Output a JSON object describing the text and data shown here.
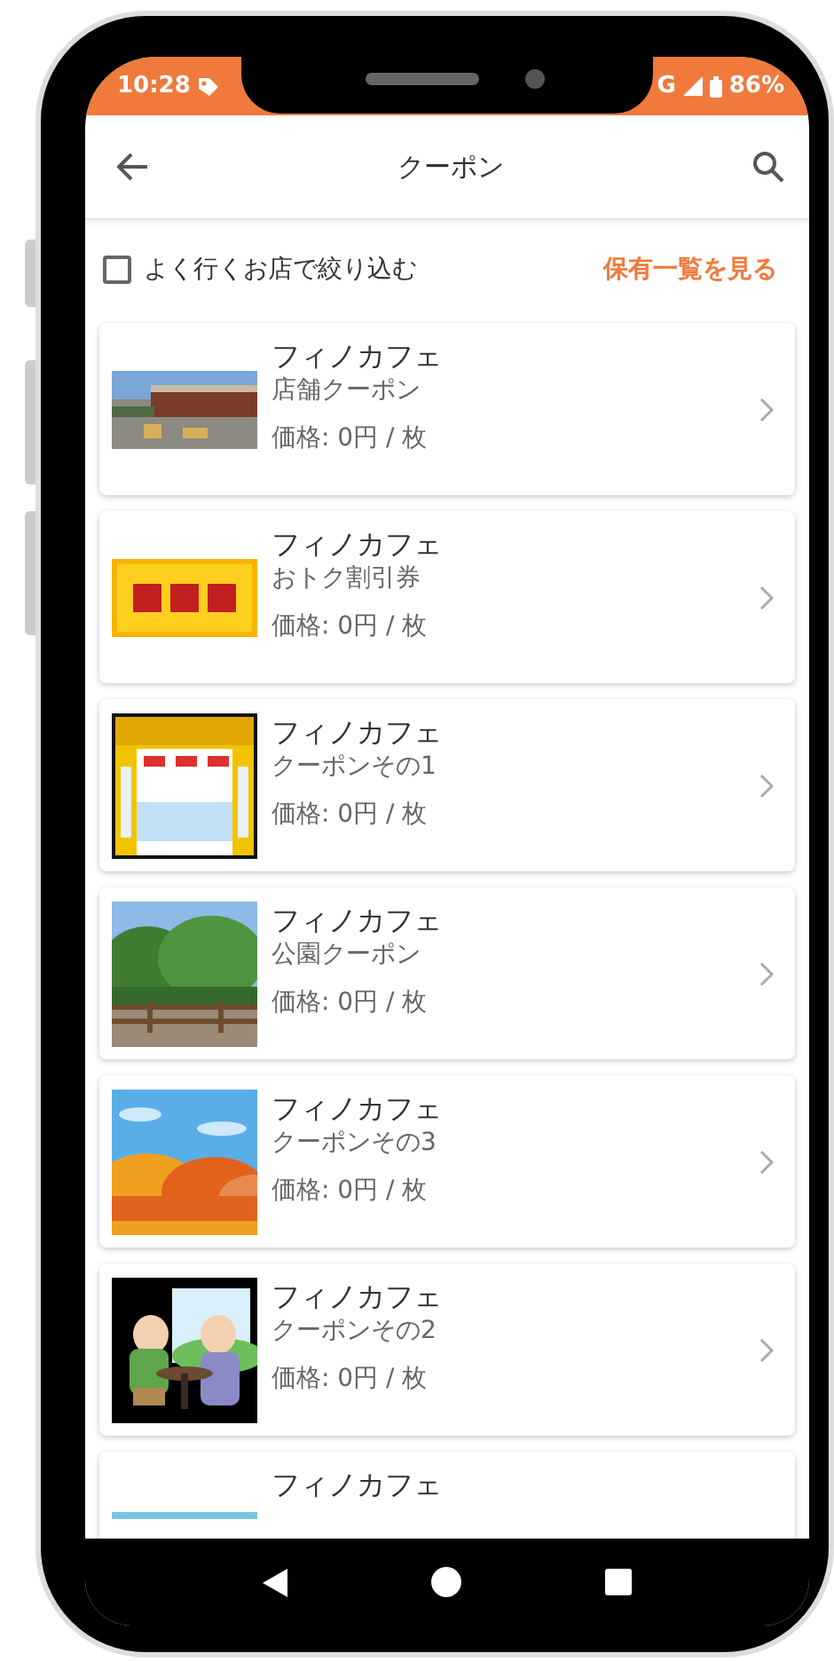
{
  "status_bar": {
    "time": "10:28",
    "network": "G",
    "battery": "86%"
  },
  "app_bar": {
    "title": "クーポン"
  },
  "filter": {
    "label": "よく行くお店で絞り込む",
    "checked": false,
    "link": "保有一覧を見る"
  },
  "coupons": [
    {
      "shop": "フィノカフェ",
      "name": "店舗クーポン",
      "price": "価格: 0円 / 枚"
    },
    {
      "shop": "フィノカフェ",
      "name": "おトク割引券",
      "price": "価格: 0円 / 枚"
    },
    {
      "shop": "フィノカフェ",
      "name": "クーポンその1",
      "price": "価格: 0円 / 枚"
    },
    {
      "shop": "フィノカフェ",
      "name": "公園クーポン",
      "price": "価格: 0円 / 枚"
    },
    {
      "shop": "フィノカフェ",
      "name": "クーポンその3",
      "price": "価格: 0円 / 枚"
    },
    {
      "shop": "フィノカフェ",
      "name": "クーポンその2",
      "price": "価格: 0円 / 枚"
    },
    {
      "shop": "フィノカフェ"
    }
  ]
}
